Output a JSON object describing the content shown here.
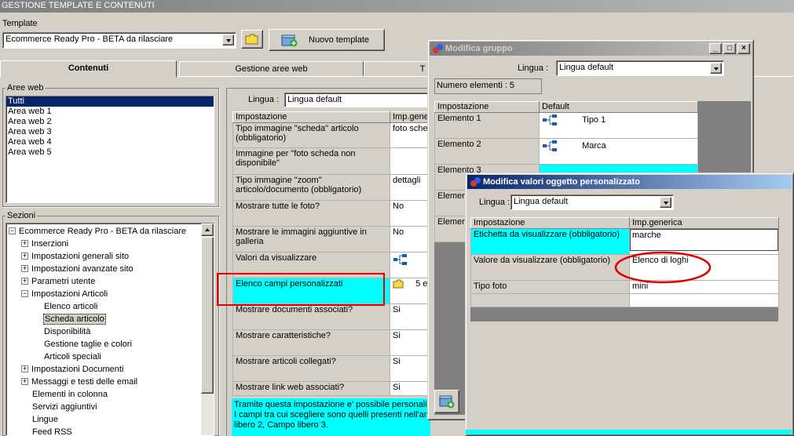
{
  "app": {
    "title": "GESTIONE TEMPLATE E CONTENUTI",
    "template_label": "Template",
    "template_value": "Ecommerce Ready Pro - BETA da rilasciare",
    "new_template_label": "Nuovo template"
  },
  "tabs": [
    {
      "label": "Contenuti"
    },
    {
      "label": "Gestione aree web"
    },
    {
      "label": "T"
    }
  ],
  "aree_web": {
    "label": "Aree web",
    "items": [
      "Tutti",
      "Area web 1",
      "Area web 2",
      "Area web 3",
      "Area web 4",
      "Area web 5"
    ]
  },
  "sezioni": {
    "label": "Sezioni",
    "tree": [
      {
        "label": "Ecommerce Ready Pro - BETA da rilasciare",
        "exp": "−"
      },
      {
        "label": "Inserzioni",
        "exp": "+"
      },
      {
        "label": "Impostazioni generali sito",
        "exp": "+"
      },
      {
        "label": "Impostazioni avanzate sito",
        "exp": "+"
      },
      {
        "label": "Parametri utente",
        "exp": "+"
      },
      {
        "label": "Impostazioni Articoli",
        "exp": "−"
      },
      {
        "label": "Elenco articoli"
      },
      {
        "label": "Scheda articolo"
      },
      {
        "label": "Disponibilità"
      },
      {
        "label": "Gestione taglie e colori"
      },
      {
        "label": "Articoli speciali"
      },
      {
        "label": "Impostazioni Documenti",
        "exp": "+"
      },
      {
        "label": "Messaggi e testi delle email",
        "exp": "+"
      },
      {
        "label": "Elementi in colonna"
      },
      {
        "label": "Servizi aggiuntivi"
      },
      {
        "label": "Lingue"
      },
      {
        "label": "Feed RSS"
      }
    ]
  },
  "main": {
    "lingua_label": "Lingua :",
    "lingua_value": "Lingua default",
    "col_impostazione": "Impostazione",
    "col_imp_generica": "Imp.gene",
    "rows": [
      {
        "label": "Tipo immagine \"scheda\" articolo (obbligatorio)",
        "value": "foto sche"
      },
      {
        "label": "Immagine per \"foto scheda non disponibile\"",
        "value": ""
      },
      {
        "label": "Tipo immagine \"zoom\" articolo/documento (obbligatorio)",
        "value": "dettagli"
      },
      {
        "label": "Mostrare tutte le foto?",
        "value": "No"
      },
      {
        "label": "Mostrare le immagini aggiuntive in galleria",
        "value": "No"
      },
      {
        "label": "Valori da visualizzare",
        "value": ""
      },
      {
        "label": "Elenco campi personalizzati",
        "value": "5 e"
      },
      {
        "label": "Mostrare documenti associati?",
        "value": "Si"
      },
      {
        "label": "Mostrare caratteristiche?",
        "value": "Si"
      },
      {
        "label": "Mostrare articoli collegati?",
        "value": "Si"
      },
      {
        "label": "Mostrare link web associati?",
        "value": "Si"
      }
    ],
    "description_lines": [
      "Tramite questa impostazione e' possibile personaliz",
      "I campi tra cui scegliere sono quelli presenti nell'ana",
      "libero 2, Campo libero 3."
    ]
  },
  "modifica_gruppo": {
    "title": "Modifica gruppo",
    "lingua_label": "Lingua :",
    "lingua_value": "Lingua default",
    "count_label": "Numero elementi : 5",
    "col_impostazione": "Impostazione",
    "col_default": "Default",
    "rows": [
      {
        "label": "Elemento 1",
        "value": "Tipo 1"
      },
      {
        "label": "Elemento 2",
        "value": "Marca"
      },
      {
        "label": "Elemento 3",
        "value": ""
      },
      {
        "label": "Elemen",
        "value": ""
      },
      {
        "label": "Elemen",
        "value": ""
      }
    ]
  },
  "modifica_valori": {
    "title": "Modifica valori oggetto personalizzato",
    "lingua_label": "Lingua :",
    "lingua_value": "Lingua default",
    "col_impostazione": "Impostazione",
    "col_imp_generica": "Imp.generica",
    "rows": [
      {
        "label": "Etichetta da visualizzare (obbligatorio)",
        "value": "marche"
      },
      {
        "label": "Valore da visualizzare (obbligatorio)",
        "value": "Elenco di loghi"
      },
      {
        "label": "Tipo foto",
        "value": "mini"
      }
    ]
  },
  "colors": {
    "highlight_cyan": "#00ffff",
    "annotation_red": "#e00000",
    "selection_blue": "#0a246a"
  }
}
